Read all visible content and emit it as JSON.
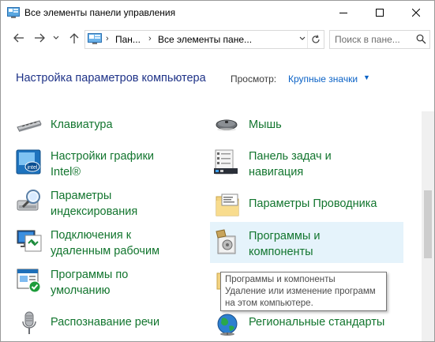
{
  "window": {
    "title": "Все элементы панели управления"
  },
  "address": {
    "crumbs": [
      "Пан...",
      "Все элементы пане..."
    ],
    "search_placeholder": "Поиск в пане..."
  },
  "header": {
    "heading": "Настройка параметров компьютера",
    "view_label": "Просмотр:",
    "view_value": "Крупные значки"
  },
  "items": [
    {
      "line1": "Клавиатура",
      "line2": "",
      "icon": "keyboard-icon"
    },
    {
      "line1": "Мышь",
      "line2": "",
      "icon": "mouse-icon"
    },
    {
      "line1": "Настройки графики",
      "line2": "Intel®",
      "icon": "intel-graphics-icon"
    },
    {
      "line1": "Панель задач и",
      "line2": "навигация",
      "icon": "taskbar-icon"
    },
    {
      "line1": "Параметры",
      "line2": "индексирования",
      "icon": "indexing-icon"
    },
    {
      "line1": "Параметры Проводника",
      "line2": "",
      "icon": "folder-options-icon"
    },
    {
      "line1": "Подключения к",
      "line2": "удаленным рабочим",
      "icon": "remote-desktop-icon"
    },
    {
      "line1": "Программы и",
      "line2": "компоненты",
      "icon": "programs-features-icon"
    },
    {
      "line1": "Программы по",
      "line2": "умолчанию",
      "icon": "default-programs-icon"
    },
    {
      "line1": "Распознавание речи",
      "line2": "",
      "icon": "microphone-icon"
    },
    {
      "line1": "Региональные стандарты",
      "line2": "",
      "icon": "globe-icon"
    }
  ],
  "tooltip": {
    "line1": "Программы и компоненты",
    "line2": "Удаление или изменение программ",
    "line3": "на этом компьютере."
  },
  "colors": {
    "link_green": "#12752e",
    "heading_blue": "#1e3287",
    "accent_blue": "#0a62c6",
    "hover_bg": "#e5f3fb"
  }
}
